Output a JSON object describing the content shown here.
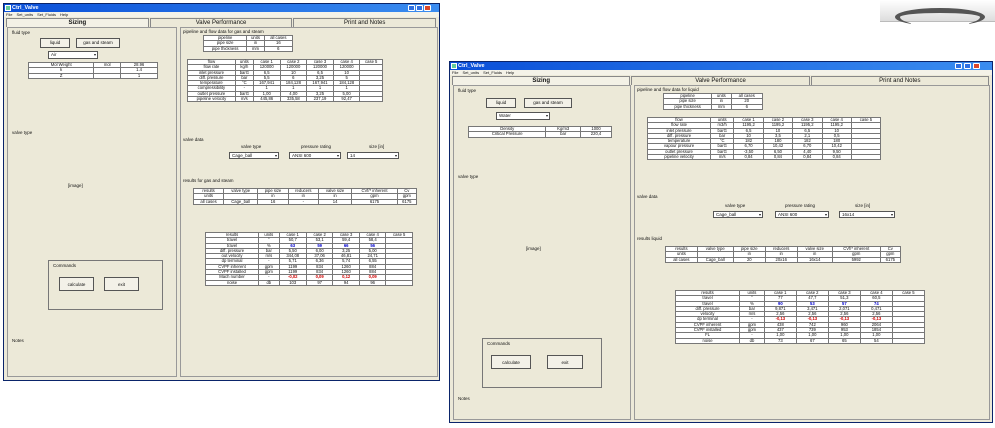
{
  "w1": {
    "title": "Ctrl_Valve",
    "menu": [
      "File",
      "Set_units",
      "Set_Fluids",
      "Help"
    ],
    "tabs": [
      "Sizing",
      "Valve Performance",
      "Print and Notes"
    ],
    "fluid_type_label": "fluid type",
    "liquid_btn": "liquid",
    "gas_btn": "gas and steam",
    "fluid_select": "Air",
    "mol_headers": [
      "Mol Weight",
      "mol",
      "28.96"
    ],
    "mol_row2": [
      "k",
      "",
      "1.4"
    ],
    "mol_row3": [
      "Z",
      "",
      "1"
    ],
    "valve_type_label": "valve type",
    "image_ph": "[image]",
    "commands_label": "Commands",
    "calc_btn": "calculate",
    "exit_btn": "exit",
    "notes_label": "Notes",
    "pipe_title": "pipeline and flow data for gas and steam",
    "pipe_tbl": [
      [
        "pipeline",
        "units",
        "all cases"
      ],
      [
        "pipe size",
        "in",
        "16"
      ],
      [
        "pipe thickness",
        "mm",
        "6"
      ]
    ],
    "flow_tbl": [
      [
        "flow",
        "units",
        "case 1",
        "case 2",
        "case 3",
        "case 4",
        "case 5"
      ],
      [
        "flow rate",
        "kg/h",
        "120000",
        "120000",
        "120000",
        "120000",
        ""
      ],
      [
        "inlet pressure",
        "barG",
        "6,5",
        "10",
        "6,5",
        "10",
        ""
      ],
      [
        "diff. pressure",
        "bar",
        "5,5",
        "6",
        "3,25",
        "5",
        ""
      ],
      [
        "temperature",
        "°C",
        "167,941",
        "184,128",
        "167,941",
        "184,128",
        ""
      ],
      [
        "compressibility",
        "-",
        "1",
        "1",
        "1",
        "1",
        ""
      ],
      [
        "outlet pressure",
        "barG",
        "1,00",
        "4,00",
        "3,25",
        "5,00",
        ""
      ],
      [
        "pipeline velocity",
        "m/s",
        "445,86",
        "335,58",
        "237,19",
        "92,47",
        ""
      ]
    ],
    "valve_data_label": "valve data",
    "vt_hdr": "valve type",
    "pr_hdr": "pressure rating",
    "size_hdr": "size [in]",
    "vt_val": "Cage_ball",
    "pr_val": "ANSI 600",
    "size_val": "14",
    "results_title": "results for gas and steam",
    "res1_tbl": [
      [
        "results",
        "valve type",
        "pipe size",
        "reducers",
        "valve size",
        "CVf/* inherent",
        "Cv"
      ],
      [
        "units",
        "",
        "in",
        "in",
        "in",
        "gpm",
        "gpm"
      ],
      [
        "all cases",
        "Cage_ball",
        "16",
        "-",
        "14",
        "6175",
        "6175"
      ]
    ],
    "res2_tbl": [
      [
        "results",
        "units",
        "case 1",
        "case 2",
        "case 3",
        "case 4",
        "case 5"
      ],
      [
        "travel",
        "°",
        "50,7",
        "53,1",
        "59,4",
        "58,4",
        ""
      ],
      [
        "travel",
        "%",
        "63",
        "59",
        "66",
        "56",
        ""
      ],
      [
        "diff. pressure",
        "bar",
        "5,50",
        "6,00",
        "3,25",
        "5,00",
        ""
      ],
      [
        "out velocity",
        "m/s",
        "344,08",
        "37,06",
        "46,81",
        "24,71",
        ""
      ],
      [
        "dp terminal",
        "-",
        "5,71",
        "6,36",
        "5,74",
        "6,55",
        ""
      ],
      [
        "CVPF inherent",
        "gpm",
        "1199",
        "834",
        "1260",
        "884",
        ""
      ],
      [
        "CVPF installed",
        "gpm",
        "1199",
        "834",
        "1260",
        "884",
        ""
      ],
      [
        "Mach number",
        "-",
        "-0,02",
        "0,09",
        "0,12",
        "0,09",
        ""
      ],
      [
        "noise",
        "db",
        "103",
        "97",
        "94",
        "96",
        ""
      ]
    ]
  },
  "w2": {
    "title": "Ctrl_Valve",
    "menu": [
      "File",
      "Set_units",
      "Set_Fluids",
      "Help"
    ],
    "tabs": [
      "Sizing",
      "Valve Performance",
      "Print and Notes"
    ],
    "fluid_type_label": "fluid type",
    "liquid_btn": "liquid",
    "gas_btn": "gas and steam",
    "fluid_select": "Water",
    "dens_row": [
      "Density",
      "Kg/m3",
      "1000"
    ],
    "crit_row": [
      "Critical Pressure",
      "bar",
      "220,4"
    ],
    "valve_type_label": "valve type",
    "image_ph": "[image]",
    "commands_label": "Commands",
    "calc_btn": "calculate",
    "exit_btn": "exit",
    "notes_label": "Notes",
    "pipe_title": "pipeline and flow data for liquid",
    "pipe_tbl": [
      [
        "pipeline",
        "units",
        "all cases"
      ],
      [
        "pipe size",
        "in",
        "20"
      ],
      [
        "pipe thickness",
        "mm",
        "6"
      ]
    ],
    "flow_tbl": [
      [
        "flow",
        "units",
        "case 1",
        "case 2",
        "case 3",
        "case 4",
        "case 5"
      ],
      [
        "flow rate",
        "m3/h",
        "1195,2",
        "1195,2",
        "1195,2",
        "1195,2",
        ""
      ],
      [
        "inlet pressure",
        "barG",
        "6,5",
        "10",
        "6,5",
        "10",
        ""
      ],
      [
        "diff. pressure",
        "bar",
        "10",
        "3,5",
        "2,1",
        "0,5",
        ""
      ],
      [
        "temperature",
        "°C",
        "182",
        "180",
        "182",
        "180",
        ""
      ],
      [
        "vapour pressure",
        "barG",
        "6,70",
        "10,42",
        "6,70",
        "10,42",
        ""
      ],
      [
        "outlet pressure",
        "barG",
        "-3,50",
        "6,50",
        "4,40",
        "9,50",
        ""
      ],
      [
        "pipeline velocity",
        "m/s",
        "0,84",
        "0,84",
        "0,84",
        "0,84",
        ""
      ]
    ],
    "valve_data_label": "valve data",
    "vt_hdr": "valve type",
    "pr_hdr": "pressure rating",
    "size_hdr": "size [in]",
    "vt_val": "Cage_ball",
    "pr_val": "ANSI 600",
    "size_val": "16x14",
    "results_title": "results liquid",
    "res1_tbl": [
      [
        "results",
        "valve type",
        "pipe size",
        "reducers",
        "valve size",
        "CVf/* inherent",
        "Cv"
      ],
      [
        "units",
        "",
        "in",
        "in",
        "in",
        "gpm",
        "gpm"
      ],
      [
        "all cases",
        "Cage_ball",
        "20",
        "20x16",
        "16x14",
        "5992",
        "6175"
      ]
    ],
    "res2_tbl": [
      [
        "results",
        "units",
        "case 1",
        "case 2",
        "case 3",
        "case 4",
        "case 5"
      ],
      [
        "travel",
        "°",
        "77",
        "47,7",
        "51,3",
        "60,5",
        ""
      ],
      [
        "travel",
        "%",
        "90",
        "53",
        "57",
        "74",
        ""
      ],
      [
        "diff. pressure",
        "bar",
        "9,871",
        "3,471",
        "2,071",
        "0,471",
        ""
      ],
      [
        "velocity",
        "m/s",
        "2,56",
        "2,56",
        "2,56",
        "2,56",
        ""
      ],
      [
        "dp terminal",
        "-",
        "-0,13",
        "-0,13",
        "-0,13",
        "-0,13",
        ""
      ],
      [
        "CVPF inherent",
        "gpm",
        "438",
        "742",
        "960",
        "2064",
        ""
      ],
      [
        "CVPF installed",
        "gpm",
        "437",
        "739",
        "953",
        "1854",
        ""
      ],
      [
        "FL",
        "-",
        "1,00",
        "1,00",
        "1,00",
        "1,00",
        ""
      ],
      [
        "noise",
        "db",
        "73",
        "67",
        "65",
        "54",
        ""
      ]
    ]
  }
}
